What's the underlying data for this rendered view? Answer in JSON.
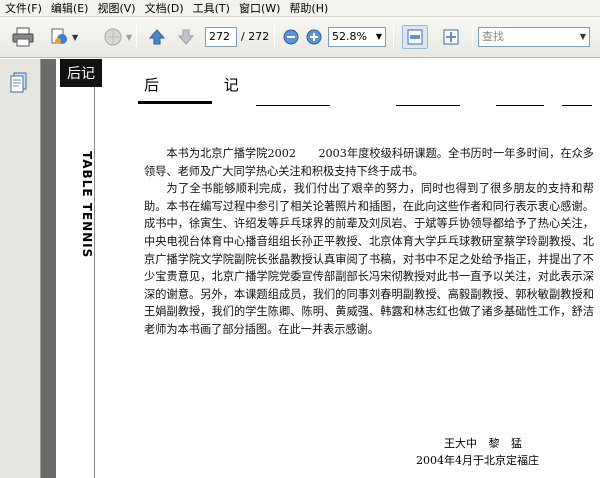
{
  "menu": [
    "文件(F)",
    "编辑(E)",
    "视图(V)",
    "文档(D)",
    "工具(T)",
    "窗口(W)",
    "帮助(H)"
  ],
  "toolbar": {
    "page_current": "272",
    "page_total": "/ 272",
    "zoom": "52.8%",
    "search_placeholder": "查找"
  },
  "page": {
    "tab_char": "后记",
    "vertical_text": "TABLE TENNIS",
    "heading": "后 记",
    "paragraphs": [
      "本书为北京广播学院2002　　2003年度校级科研课题。全书历时一年多时间，在众多领导、老师及广大同学热心关注和积极支持下终于成书。",
      "为了全书能够顺利完成，我们付出了艰辛的努力，同时也得到了很多朋友的支持和帮助。本书在编写过程中参引了相关论著照片和插图，在此向这些作者和同行表示衷心感谢。成书中，徐寅生、许绍发等乒乓球界的前辈及刘凤岩、于斌等乒协领导都给予了热心关注，中央电视台体育中心播音组组长孙正平教授、北京体育大学乒乓球教研室蔡学玲副教授、北京广播学院文学院副院长张晶教授认真审阅了书稿，对书中不足之处给予指正，并提出了不少宝贵意见，北京广播学院党委宣传部副部长冯宋彻教授对此书一直予以关注，对此表示深深的谢意。另外，本课题组成员，我们的同事刘春明副教授、高毅副教授、郭秋敏副教授和王娟副教授，我们的学生陈卿、陈明、黄威强、韩露和林志红也做了诸多基础性工作，舒洁老师为本书画了部分插图。在此一并表示感谢。"
    ],
    "signature_names": "王大中 黎 猛",
    "signature_date": "2004年4月于北京定福庄"
  }
}
